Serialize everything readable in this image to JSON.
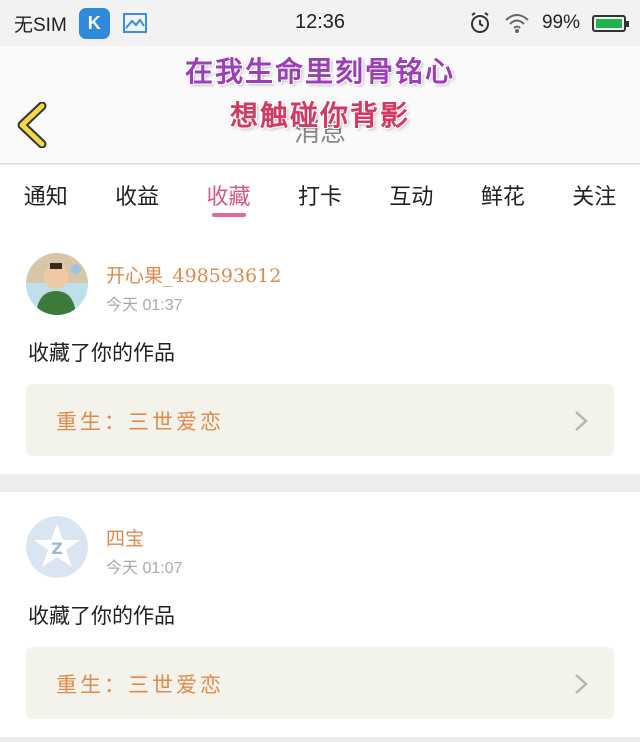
{
  "status_bar": {
    "carrier": "无SIM",
    "time": "12:36",
    "battery": "99%",
    "battery_level": 0.99,
    "app_badge_letter": "K"
  },
  "header": {
    "title": "消息",
    "overlay_line1": "在我生命里刻骨铭心",
    "overlay_line2": "想触碰你背影"
  },
  "tabs": [
    {
      "label": "通知"
    },
    {
      "label": "收益"
    },
    {
      "label": "收藏"
    },
    {
      "label": "打卡"
    },
    {
      "label": "互动"
    },
    {
      "label": "鲜花"
    },
    {
      "label": "关注"
    }
  ],
  "active_tab": "收藏",
  "messages": [
    {
      "username": "开心果_498593612",
      "time": "今天 01:37",
      "action": "收藏了你的作品",
      "work_title": "重生：三世爱恋"
    },
    {
      "username": "四宝",
      "time": "今天 01:07",
      "action": "收藏了你的作品",
      "work_title": "重生：三世爱恋"
    }
  ],
  "colors": {
    "accent": "#e1689a",
    "username": "#e08a4c",
    "back_arrow": "#f2d64b"
  }
}
